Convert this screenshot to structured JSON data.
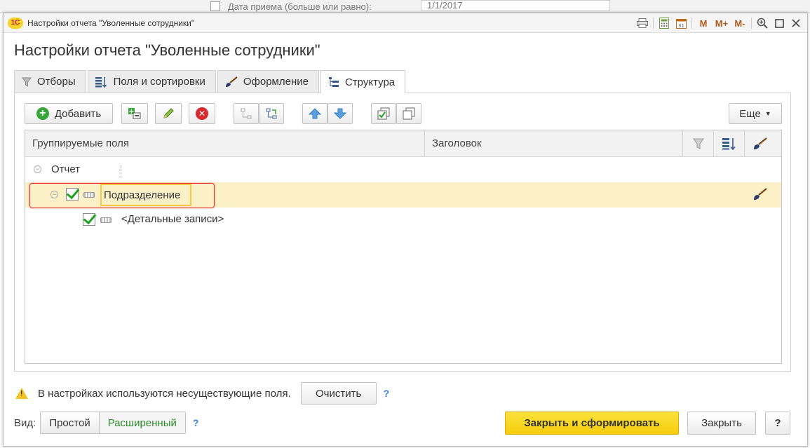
{
  "background": {
    "field_label": "Дата приема (больше или равно):",
    "date_value": "1/1/2017"
  },
  "window": {
    "title": "Настройки отчета \"Уволенные сотрудники\"",
    "logo": "1С",
    "titlebar_icons": [
      "print-icon",
      "calculator-icon",
      "calendar-icon",
      "M",
      "M+",
      "M-",
      "zoom-icon",
      "maximize-icon",
      "close-icon"
    ]
  },
  "form": {
    "title": "Настройки отчета \"Уволенные сотрудники\""
  },
  "tabs": [
    {
      "label": "Отборы",
      "icon": "filter-icon"
    },
    {
      "label": "Поля и сортировки",
      "icon": "sort-icon"
    },
    {
      "label": "Оформление",
      "icon": "brush-icon"
    },
    {
      "label": "Структура",
      "icon": "structure-icon",
      "active": true
    }
  ],
  "toolbar": {
    "add_label": "Добавить",
    "more_label": "Еще",
    "icons": [
      "add-field-icon",
      "pencil-icon",
      "delete-icon",
      "group-icon",
      "ungroup-icon",
      "move-up-icon",
      "move-down-icon",
      "check-all-icon",
      "uncheck-all-icon"
    ]
  },
  "table": {
    "columns": [
      "Группируемые поля",
      "Заголовок"
    ],
    "icon_columns": [
      "filter-icon",
      "sort-icon",
      "brush-icon"
    ],
    "rows": [
      {
        "label": "Отчет",
        "level": 0,
        "checkbox": false,
        "selected": false
      },
      {
        "label": "Подразделение",
        "level": 1,
        "checkbox": true,
        "checked": true,
        "selected": true
      },
      {
        "label": "<Детальные записи>",
        "level": 2,
        "checkbox": true,
        "checked": true,
        "selected": false
      }
    ]
  },
  "warning": {
    "text": "В настройках используются несуществующие поля.",
    "button_label": "Очистить",
    "help": "?"
  },
  "view": {
    "label": "Вид:",
    "options": [
      "Простой",
      "Расширенный"
    ],
    "selected": "Расширенный",
    "help": "?"
  },
  "footer": {
    "primary_label": "Закрыть и сформировать",
    "close_label": "Закрыть",
    "help": "?"
  },
  "colors": {
    "accent_yellow": "#f5cd0b",
    "selected_row": "#fbf0c8",
    "highlight_frame": "#e02f2f",
    "check_green": "#22a022",
    "link_blue": "#3b82d6"
  }
}
